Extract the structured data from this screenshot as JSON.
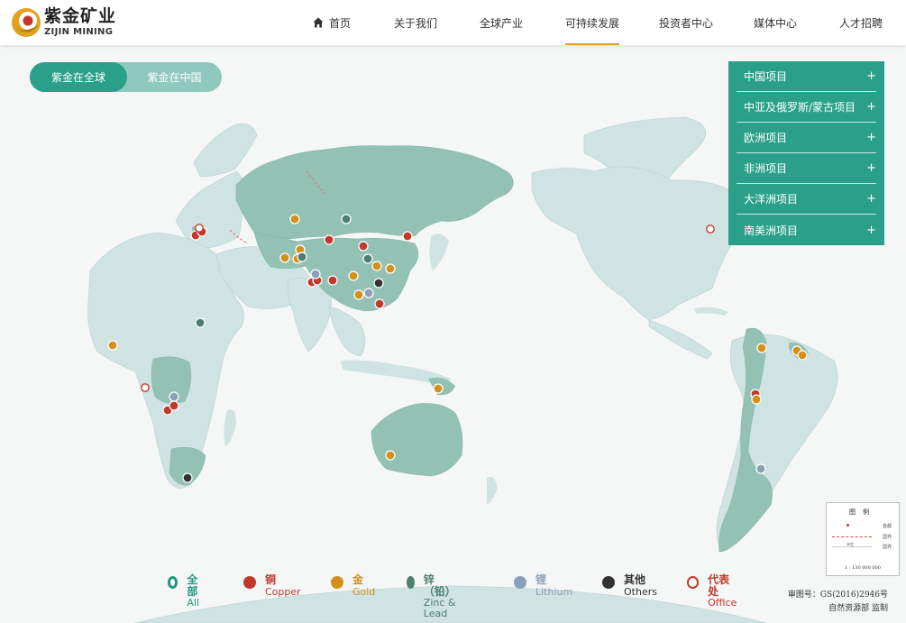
{
  "logo": {
    "cn": "紫金矿业",
    "en": "ZIJIN MINING"
  },
  "nav": [
    {
      "label": "首页",
      "icon": "home-icon"
    },
    {
      "label": "关于我们"
    },
    {
      "label": "全球产业"
    },
    {
      "label": "可持续发展",
      "active": true
    },
    {
      "label": "投资者中心"
    },
    {
      "label": "媒体中心"
    },
    {
      "label": "人才招聘"
    }
  ],
  "toggle": {
    "global": "紫金在全球",
    "china": "紫金在中国"
  },
  "regions": [
    "中国项目",
    "中亚及俄罗斯/蒙古项目",
    "欧洲项目",
    "非洲项目",
    "大洋洲项目",
    "南美洲项目"
  ],
  "region_plus": "+",
  "legend": [
    {
      "cn": "全部",
      "en": "All",
      "color": "#1f9a7f",
      "style": "ring"
    },
    {
      "cn": "铜",
      "en": "Copper",
      "color": "#c0392b",
      "style": "dot"
    },
    {
      "cn": "金",
      "en": "Gold",
      "color": "#d4901d",
      "style": "dot"
    },
    {
      "cn": "锌（铅）",
      "en": "Zinc & Lead",
      "color": "#4d7f70",
      "style": "dot"
    },
    {
      "cn": "锂",
      "en": "Lithium",
      "color": "#8aa0b8",
      "style": "dot"
    },
    {
      "cn": "其他",
      "en": "Others",
      "color": "#333333",
      "style": "dot"
    },
    {
      "cn": "代表处",
      "en": "Office",
      "color": "#c0392b",
      "style": "ring"
    }
  ],
  "map_key": {
    "title": "图例",
    "capital": "首都",
    "undetermined": "未定",
    "border": "国界",
    "national": "国界",
    "scale": "1 : 130 000 000"
  },
  "approval": {
    "line1": "审图号：GS(2016)2946号",
    "line2": "自然资源部  监制"
  },
  "colors": {
    "accent": "#2aa08a",
    "ocean": "#f5f6f6",
    "land": "#cfe3e2",
    "highlight": "#93c2b5"
  }
}
